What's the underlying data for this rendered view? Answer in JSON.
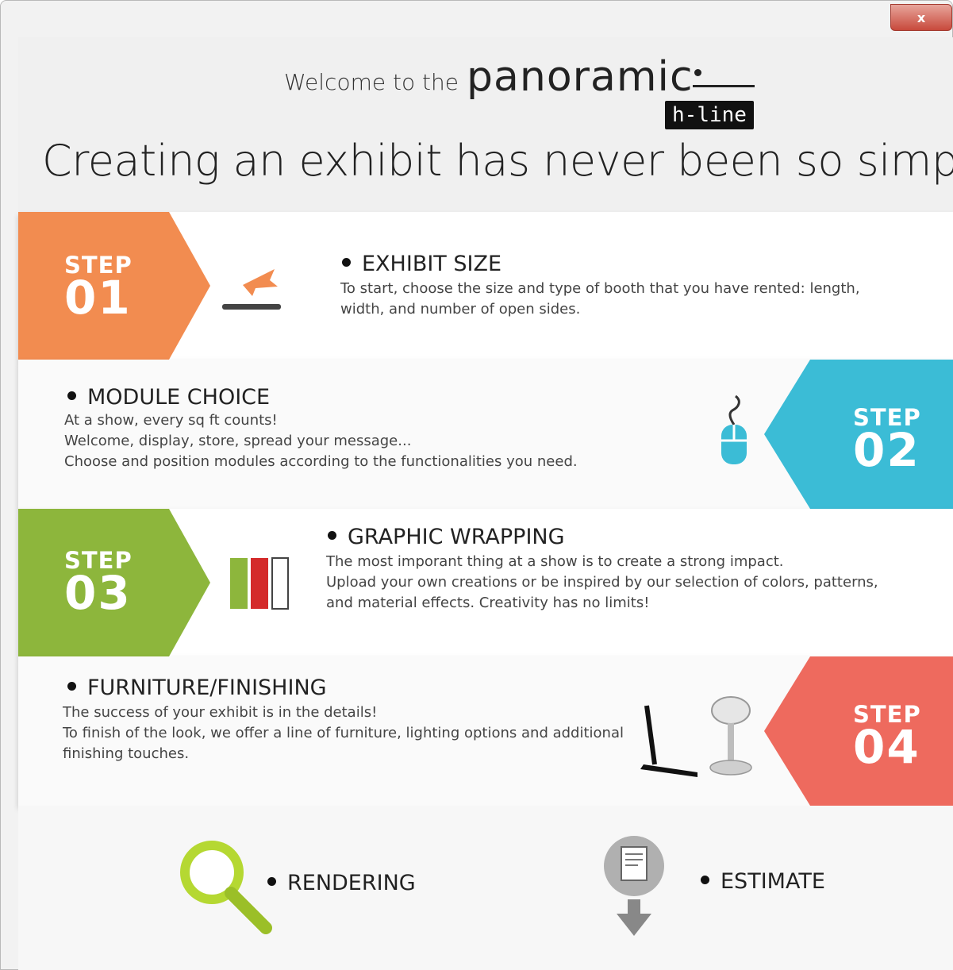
{
  "window": {
    "close_label": "x"
  },
  "header": {
    "welcome_text": "Welcome to the",
    "brand_name": "panoramic",
    "brand_badge": "h-line",
    "headline": "Creating an exhibit has never been so simple"
  },
  "colors": {
    "step1": "#f28c50",
    "step2": "#3bbcd6",
    "step3": "#8db63c",
    "step4": "#ee6a5e",
    "accent_red": "#d42a2a",
    "lime": "#b5d832"
  },
  "steps": [
    {
      "word": "STEP",
      "number": "01",
      "title": "EXHIBIT SIZE",
      "lines": [
        "To start, choose the size and type of booth that you have rented: length,",
        "width, and number of open sides."
      ],
      "icon": "arrow-into-surface-icon"
    },
    {
      "word": "STEP",
      "number": "02",
      "title": "MODULE CHOICE",
      "lines": [
        "At a show, every sq ft counts!",
        "Welcome, display, store, spread your message...",
        "Choose and position modules according to the functionalities you need."
      ],
      "icon": "mouse-icon"
    },
    {
      "word": "STEP",
      "number": "03",
      "title": "GRAPHIC WRAPPING",
      "lines": [
        "The most imporant thing at a show is to create a strong impact.",
        "Upload your own creations or be inspired by our selection of colors, patterns,",
        "and material effects. Creativity has no limits!"
      ],
      "icon": "color-swatches-icon"
    },
    {
      "word": "STEP",
      "number": "04",
      "title": "FURNITURE/FINISHING",
      "lines": [
        "The success of your exhibit is in the details!",
        "To finish of the look, we offer a line of furniture, lighting options and additional",
        "finishing touches."
      ],
      "icon": "furniture-icon"
    }
  ],
  "bottom": {
    "rendering": "RENDERING",
    "estimate": "ESTIMATE"
  }
}
